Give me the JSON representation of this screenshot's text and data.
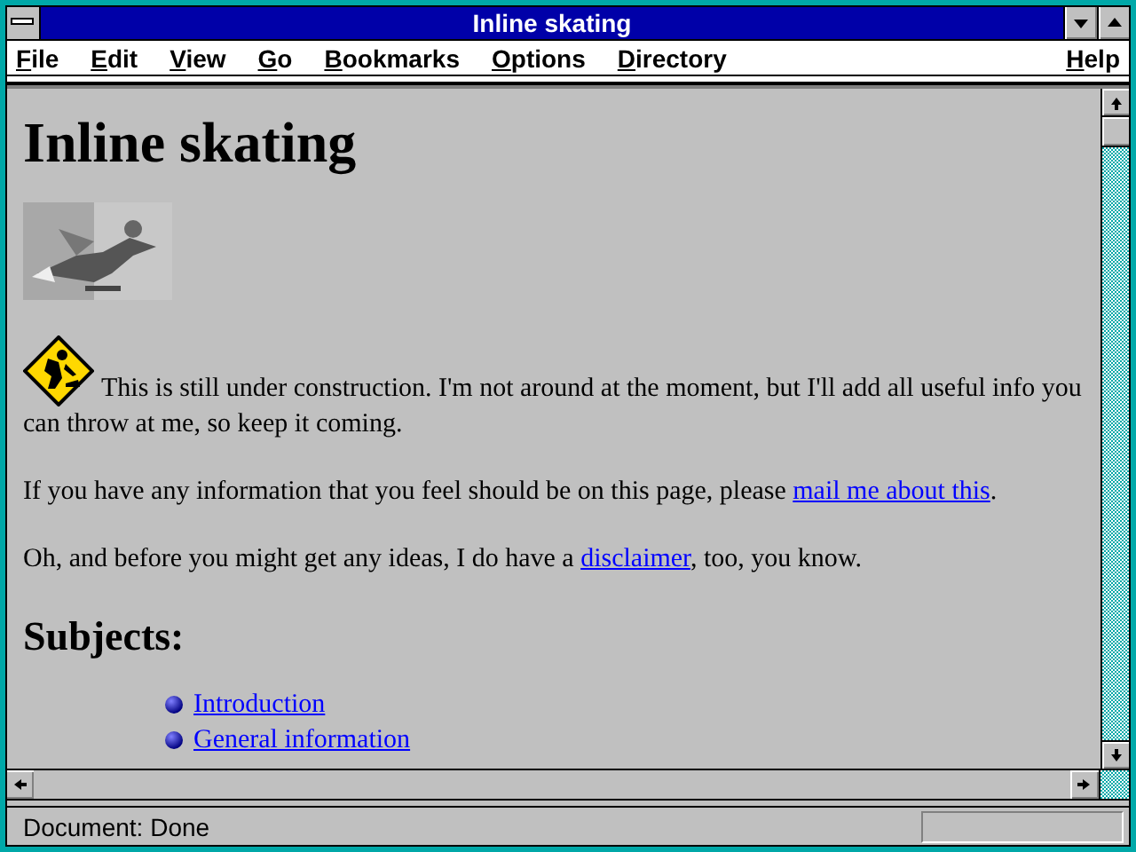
{
  "window": {
    "title": "Inline skating"
  },
  "menu": [
    "File",
    "Edit",
    "View",
    "Go",
    "Bookmarks",
    "Options",
    "Directory"
  ],
  "help_menu": "Help",
  "page": {
    "heading": "Inline skating",
    "paragraphs": [
      [
        {
          "kind": "text",
          "text": "This is still under construction. I'm not around at the moment, but I'll add all useful info you can throw at me, so keep it coming."
        }
      ],
      [
        {
          "kind": "text",
          "text": "If you have any information that you feel should be on this page, please "
        },
        {
          "kind": "link",
          "text": "mail me about this"
        },
        {
          "kind": "text",
          "text": "."
        }
      ],
      [
        {
          "kind": "text",
          "text": "Oh, and before you might get any ideas, I do have a "
        },
        {
          "kind": "link",
          "text": "disclaimer"
        },
        {
          "kind": "text",
          "text": ", too, you know."
        }
      ]
    ],
    "subheading": "Subjects:",
    "subjects": [
      "Introduction",
      "General information"
    ]
  },
  "status_bar": {
    "text": "Document: Done"
  }
}
